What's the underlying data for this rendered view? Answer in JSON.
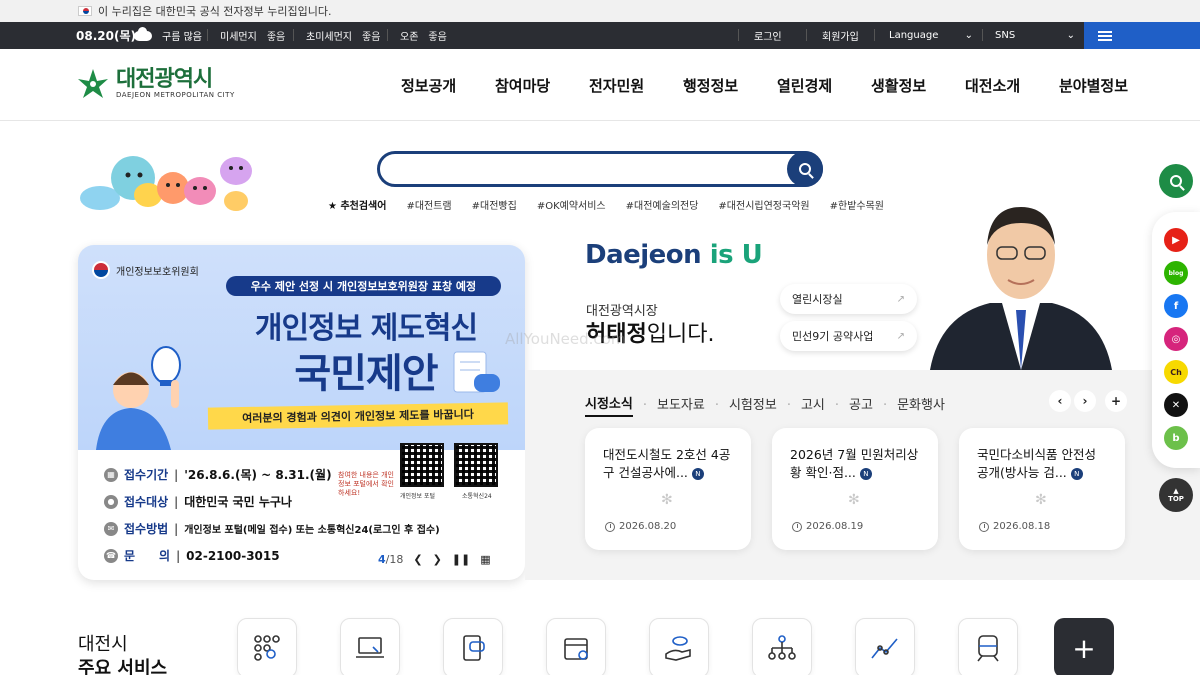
{
  "gov_banner": {
    "text": "이 누리집은 대한민국 공식 전자정부 누리집입니다."
  },
  "topbar": {
    "date": "08.20(목)",
    "weather": "구름 많음",
    "air": [
      {
        "label": "미세먼지",
        "grade": "좋음"
      },
      {
        "label": "초미세먼지",
        "grade": "좋음"
      },
      {
        "label": "오존",
        "grade": "좋음"
      }
    ],
    "login": "로그인",
    "join": "회원가입",
    "language": "Language",
    "sns": "SNS"
  },
  "header": {
    "logo_ko": "대전광역시",
    "logo_en": "DAEJEON METROPOLITAN CITY",
    "nav": [
      "정보공개",
      "참여마당",
      "전자민원",
      "행정정보",
      "열린경제",
      "생활정보",
      "대전소개",
      "분야별정보"
    ]
  },
  "search": {
    "placeholder": "",
    "rec_title": "추천검색어",
    "keywords": [
      "#대전트램",
      "#대전빵집",
      "#OK예약서비스",
      "#대전예술의전당",
      "#대전시립연정국악원",
      "#한밭수목원"
    ]
  },
  "banner": {
    "org": "개인정보보호위원회",
    "ribbon": "우수 제안 선정 시 개인정보보호위원장 표창 예정",
    "headline1": "개인정보 제도혁신",
    "headline2": "국민제안",
    "strip": "여러분의 경험과 의견이 개인정보 제도를 바꿉니다",
    "rows": [
      {
        "label": "접수기간",
        "value": "'26.8.6.(목) ~ 8.31.(월)"
      },
      {
        "label": "접수대상",
        "value": "대한민국 국민 누구나"
      },
      {
        "label": "접수방법",
        "value": "개인정보 포털(메일 접수) 또는 소통혁신24(로그인 후 접수)"
      },
      {
        "label": "문　　의",
        "value": "02-2100-3015"
      }
    ],
    "qr1_caption": "개인정보 포털",
    "qr2_caption": "소통혁신24",
    "hand_note": "참여한 내용은 개인정보 포털에서 확인하세요!",
    "pager_current": "4",
    "pager_total": "/18"
  },
  "mayor": {
    "slogan_a": "Daejeon",
    "slogan_b": " is U",
    "subtitle": "대전광역시장",
    "name": "허태정",
    "name_suffix": "입니다.",
    "links": [
      "열린시장실",
      "민선9기 공약사업"
    ]
  },
  "news": {
    "tabs": [
      "시정소식",
      "보도자료",
      "시험정보",
      "고시",
      "공고",
      "문화행사"
    ],
    "cards": [
      {
        "title": "대전도시철도 2호선 4공구 건설공사에...",
        "date": "2026.08.20"
      },
      {
        "title": "2026년 7월 민원처리상황 확인·점...",
        "date": "2026.08.19"
      },
      {
        "title": "국민다소비식품 안전성 공개(방사능 검...",
        "date": "2026.08.18"
      }
    ]
  },
  "quick": {
    "top_label": "TOP"
  },
  "services": {
    "title_line1": "대전시",
    "title_line2": "주요 서비스",
    "icons": [
      "grid-search-icon",
      "laptop-icon",
      "mobile-chat-icon",
      "calendar-icon",
      "hand-coin-icon",
      "org-chart-icon",
      "trend-chart-icon",
      "train-icon"
    ]
  },
  "watermark": "AllYouNeed.com",
  "colors": {
    "navy": "#1b3f7a",
    "green": "#1e8c46",
    "topbar": "#2b2d33",
    "menu_blue": "#1f5fc7"
  }
}
